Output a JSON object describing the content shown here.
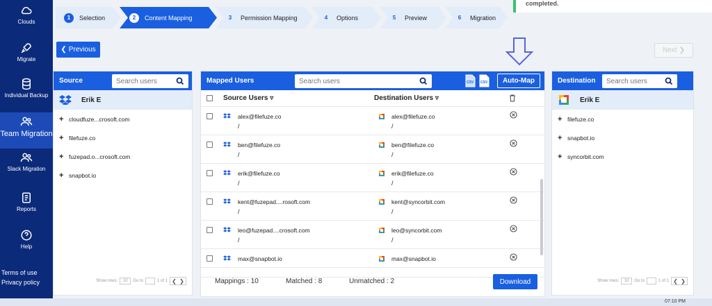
{
  "sidebar": {
    "items": [
      {
        "label": "Clouds",
        "icon": "cloud-icon"
      },
      {
        "label": "Migrate",
        "icon": "rocket-icon"
      },
      {
        "label": "Individual Backup",
        "icon": "database-icon"
      },
      {
        "label": "Team Migration",
        "icon": "team-icon"
      },
      {
        "label": "Slack Migration",
        "icon": "users-icon"
      },
      {
        "label": "Reports",
        "icon": "report-icon"
      },
      {
        "label": "Help",
        "icon": "help-icon"
      }
    ],
    "terms": "Terms of use",
    "privacy": "Privacy policy"
  },
  "stepper": [
    {
      "num": "1",
      "label": "Selection"
    },
    {
      "num": "2",
      "label": "Content Mapping"
    },
    {
      "num": "3",
      "label": "Permission Mapping"
    },
    {
      "num": "4",
      "label": "Options"
    },
    {
      "num": "5",
      "label": "Preview"
    },
    {
      "num": "6",
      "label": "Migration"
    }
  ],
  "toast": {
    "text": "completed."
  },
  "buttons": {
    "previous": "Previous",
    "next": "Next",
    "auto_map": "Auto-Map",
    "download": "Download"
  },
  "source": {
    "title": "Source",
    "search_placeholder": "Search users",
    "user": "Erik E",
    "items": [
      "cloudfuze...crosoft.com",
      "filefuze.co",
      "fuzepad.o...crosoft.com",
      "snapbot.io"
    ],
    "pager": {
      "show_rows": "Show rows:",
      "rows": "10",
      "goto": "Go to",
      "of": "1 of 1"
    }
  },
  "mapped": {
    "title": "Mapped Users",
    "search_placeholder": "Search users",
    "col_source": "Source Users",
    "col_dest": "Destination Users",
    "rows": [
      {
        "src": "alex@filefuze.co",
        "src_path": "/",
        "dst": "alex@filefuze.co",
        "dst_path": "/"
      },
      {
        "src": "ben@filefuze.co",
        "src_path": "/",
        "dst": "ben@filefuze.co",
        "dst_path": "/"
      },
      {
        "src": "erik@filefuze.co",
        "src_path": "/",
        "dst": "erik@filefuze.co",
        "dst_path": "/"
      },
      {
        "src": "kent@fuzepad....rosoft.com",
        "src_path": "/",
        "dst": "kent@syncorbit.com",
        "dst_path": "/"
      },
      {
        "src": "leo@fuzepad....crosoft.com",
        "src_path": "/",
        "dst": "leo@syncorbit.com",
        "dst_path": "/"
      },
      {
        "src": "max@snapbot.io",
        "src_path": "",
        "dst": "max@snapbot.io",
        "dst_path": ""
      }
    ],
    "footer": {
      "mappings": "Mappings : 10",
      "matched": "Matched : 8",
      "unmatched": "Unmatched : 2"
    }
  },
  "destination": {
    "title": "Destination",
    "search_placeholder": "Search users",
    "user": "Erik E",
    "items": [
      "filefuze.co",
      "snapbot.io",
      "syncorbit.com"
    ],
    "pager": {
      "show_rows": "Show rows:",
      "rows": "10",
      "goto": "Go to",
      "of": "1 of 1"
    }
  },
  "taskbar": {
    "time": "07:10 PM"
  },
  "colors": {
    "primary": "#1a5fe0",
    "sidebar": "#0b2a7a",
    "light": "#e3ecf9"
  }
}
